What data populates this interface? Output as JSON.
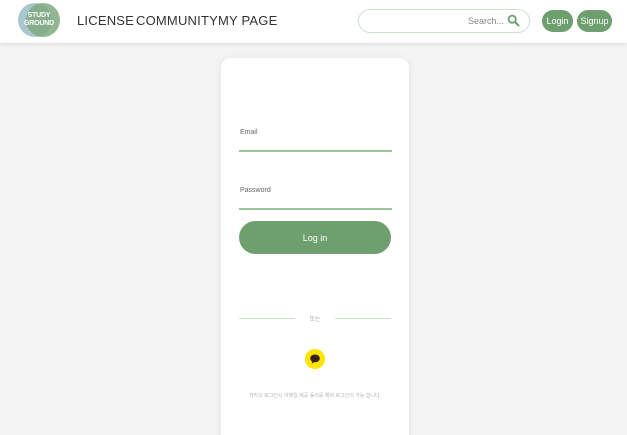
{
  "logo": {
    "line1": "STUDY",
    "line2": "GROUND"
  },
  "nav": {
    "license": "LICENSE",
    "community": "COMMUNITY",
    "mypage": "MY PAGE"
  },
  "search": {
    "placeholder": "Search...",
    "icon": "search-icon"
  },
  "header_buttons": {
    "login": "Login",
    "signup": "Signup"
  },
  "form": {
    "email_label": "Email",
    "password_label": "Password",
    "login_button": "Log in",
    "divider_text": "또는",
    "kakao_icon": "kakao-chat-icon",
    "kakao_note": "카카오 로그인시 이메일 제공 동의를 해야 로그인이 가능 합니다."
  },
  "colors": {
    "accent": "#6e9f6e",
    "accent_light": "#9dc79d",
    "logo_blue": "#a9c7cf",
    "kakao_yellow": "#fee500",
    "background": "#f4f4f4"
  }
}
